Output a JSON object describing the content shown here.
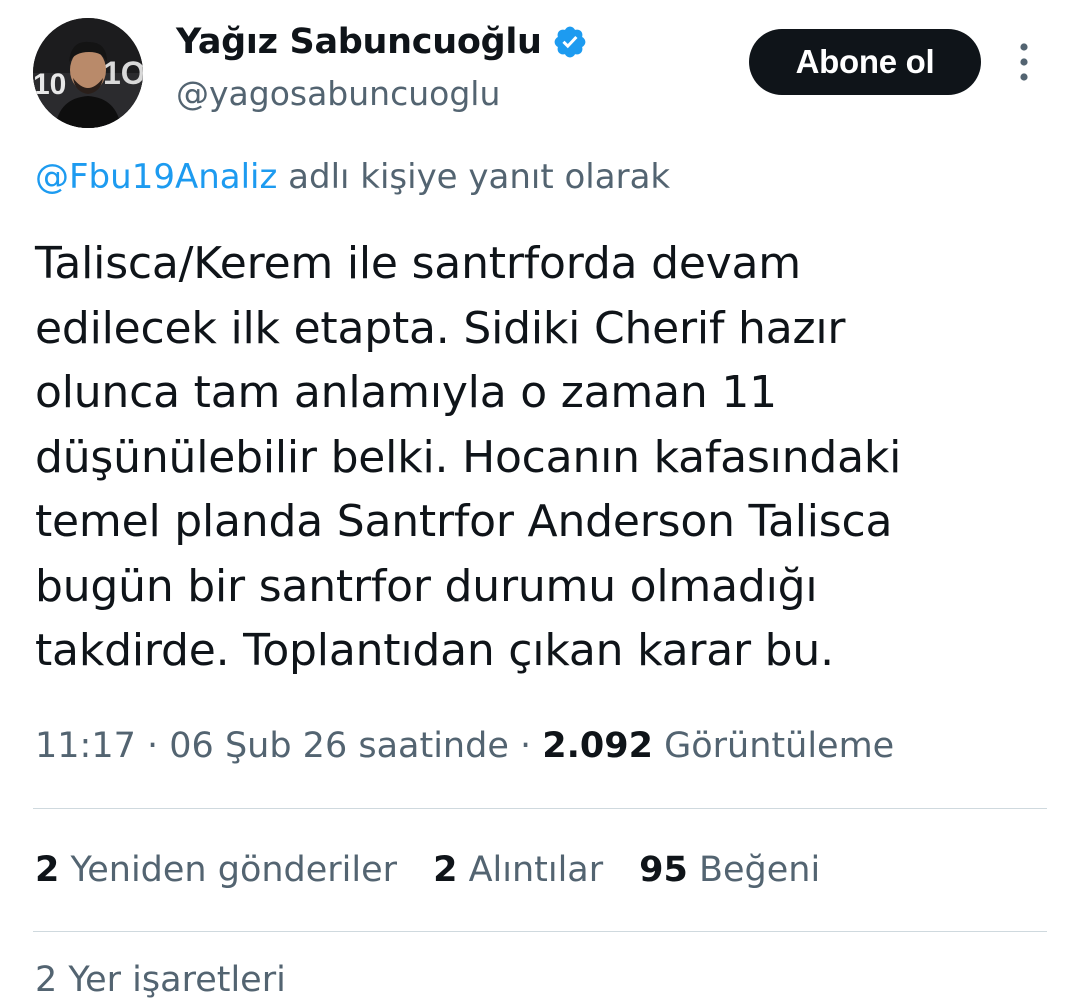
{
  "author": {
    "display_name": "Yağız Sabuncuoğlu",
    "handle": "@yagosabuncuoglu",
    "verified": true
  },
  "follow_button": {
    "label": "Abone ol"
  },
  "more_icon": "more-vertical-icon",
  "reply_context": {
    "mention": "@Fbu19Analiz",
    "suffix": " adlı kişiye yanıt olarak"
  },
  "tweet": {
    "lines": [
      "Talisca/Kerem ile santrforda devam",
      "edilecek ilk etapta. Sidiki Cherif hazır",
      "olunca tam anlamıyla o zaman 11",
      "düşünülebilir belki. Hocanın kafasındaki",
      "temel planda Santrfor Anderson Talisca",
      "bugün bir santrfor durumu olmadığı",
      "takdirde. Toplantıdan çıkan karar bu."
    ]
  },
  "meta": {
    "time": "11:17",
    "date": "06 Şub 26 saatinde",
    "views_count": "2.092",
    "views_label": "Görüntüleme"
  },
  "stats": {
    "reposts": {
      "count": "2",
      "label": "Yeniden gönderiler"
    },
    "quotes": {
      "count": "2",
      "label": "Alıntılar"
    },
    "likes": {
      "count": "95",
      "label": "Beğeni"
    }
  },
  "cutoff_text": "2 Yer işaretleri",
  "colors": {
    "accent": "#1d9bf0",
    "text": "#0f1419",
    "secondary": "#536471",
    "divider": "#cfd9de",
    "button_bg": "#0f1419"
  }
}
